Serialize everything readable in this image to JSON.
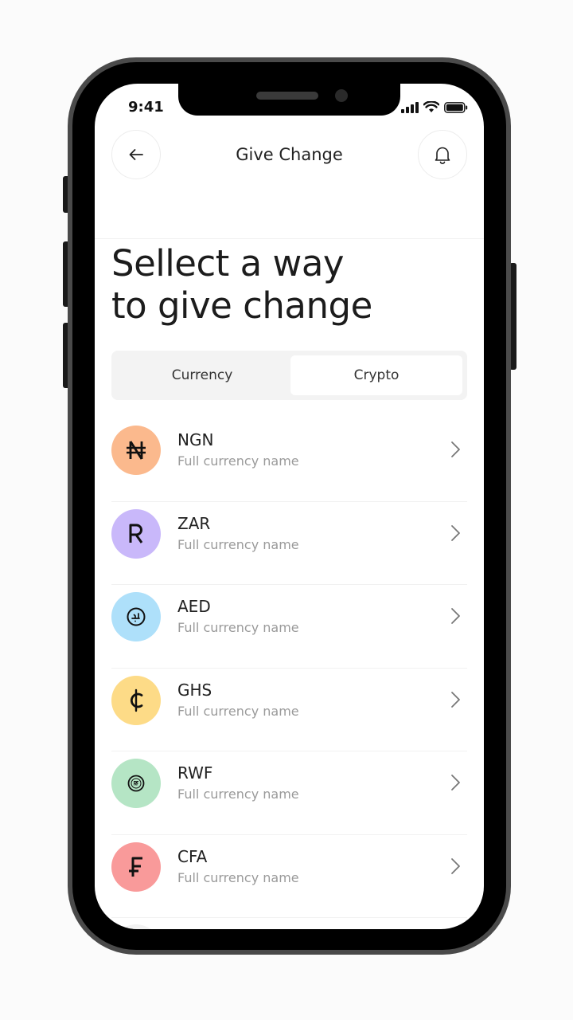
{
  "status_bar": {
    "time": "9:41"
  },
  "header": {
    "title": "Give Change"
  },
  "headline": {
    "line1": "Sellect a way",
    "line2": "to give change"
  },
  "tabs": [
    {
      "label": "Currency",
      "selected": false
    },
    {
      "label": "Crypto",
      "selected": true
    }
  ],
  "currencies": [
    {
      "code": "NGN",
      "name": "Full currency name",
      "icon": "naira-icon",
      "color": "#fbb98d"
    },
    {
      "code": "ZAR",
      "name": "Full currency name",
      "icon": "rand-icon",
      "color": "#c9b8fa"
    },
    {
      "code": "AED",
      "name": "Full currency name",
      "icon": "dirham-icon",
      "color": "#aee0fa"
    },
    {
      "code": "GHS",
      "name": "Full currency name",
      "icon": "cedi-icon",
      "color": "#fddb87"
    },
    {
      "code": "RWF",
      "name": "Full currency name",
      "icon": "franc-rwanda-icon",
      "color": "#b5e5c5"
    },
    {
      "code": "CFA",
      "name": "Full currency name",
      "icon": "franc-icon",
      "color": "#f99a9a"
    }
  ]
}
